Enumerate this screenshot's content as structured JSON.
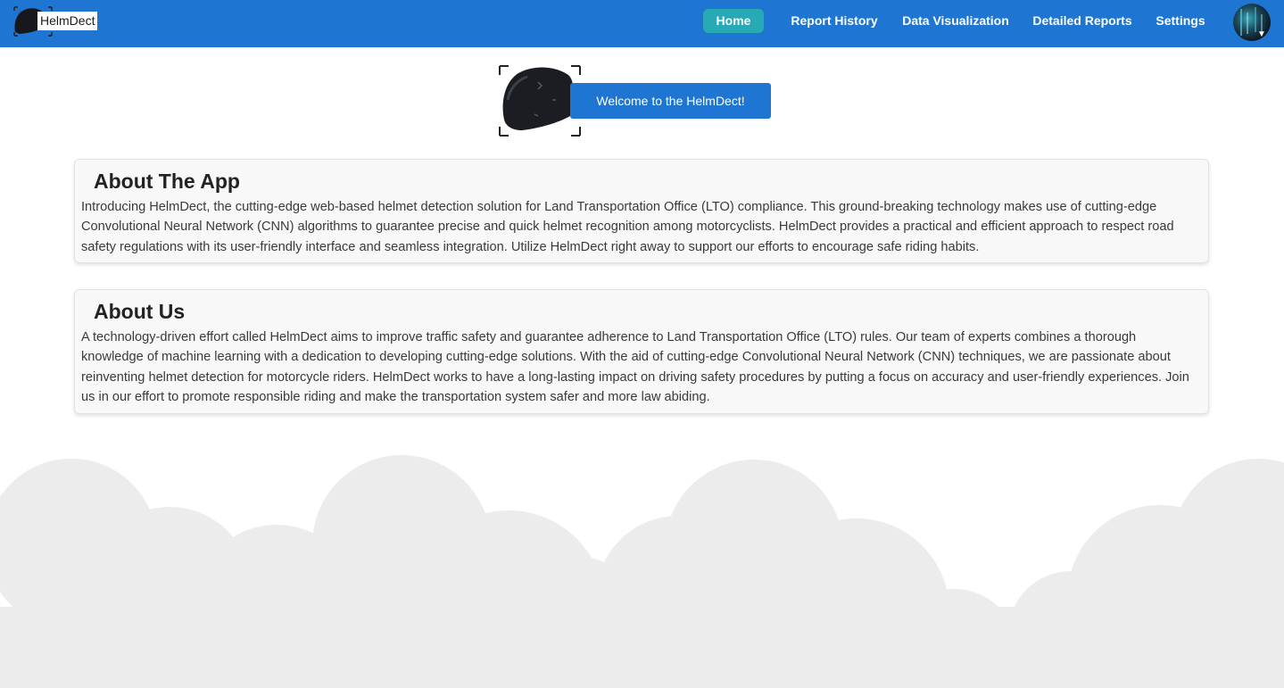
{
  "brand": {
    "name": "HelmDect"
  },
  "nav": {
    "items": [
      {
        "label": "Home",
        "active": true
      },
      {
        "label": "Report History",
        "active": false
      },
      {
        "label": "Data Visualization",
        "active": false
      },
      {
        "label": "Detailed Reports",
        "active": false
      },
      {
        "label": "Settings",
        "active": false
      }
    ],
    "avatar_icon": "user-avatar",
    "caret_icon": "caret-down-icon"
  },
  "hero": {
    "welcome": "Welcome to the HelmDect!"
  },
  "about_app": {
    "title": "About The App",
    "body": "Introducing HelmDect, the cutting-edge web-based helmet detection solution for Land Transportation Office (LTO) compliance. This ground-breaking technology makes use of cutting-edge Convolutional Neural Network (CNN) algorithms to guarantee precise and quick helmet recognition among motorcyclists. HelmDect provides a practical and efficient approach to respect road safety regulations with its user-friendly interface and seamless integration. Utilize HelmDect right away to support our efforts to encourage safe riding habits."
  },
  "about_us": {
    "title": "About Us",
    "body": "A technology-driven effort called HelmDect aims to improve traffic safety and guarantee adherence to Land Transportation Office (LTO) rules. Our team of experts combines a thorough knowledge of machine learning with a dedication to developing cutting-edge solutions. With the aid of cutting-edge Convolutional Neural Network (CNN) techniques, we are passionate about reinventing helmet detection for motorcycle riders. HelmDect works to have a long-lasting impact on driving safety procedures by putting a focus on accuracy and user-friendly experiences. Join us in our effort to promote responsible riding and make the transportation system safer and more law abiding."
  },
  "colors": {
    "navbar": "#1f76d2",
    "active_tab": "#28aab4",
    "card_bg": "#f8f8f8",
    "cloud": "#ececec"
  }
}
